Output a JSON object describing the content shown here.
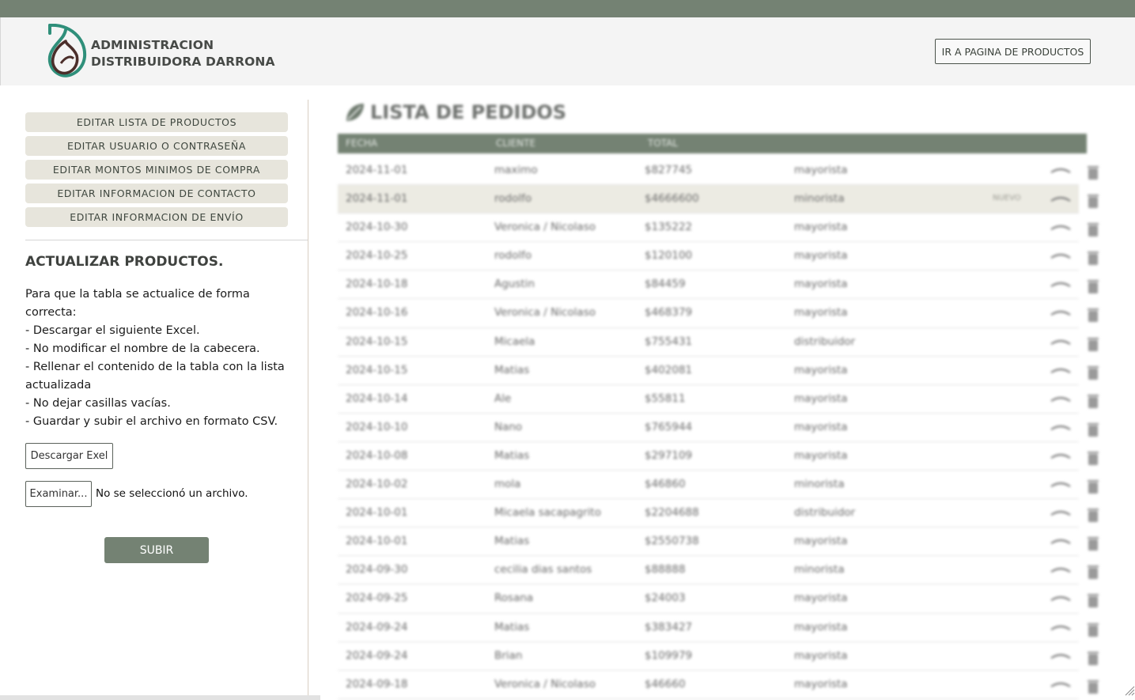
{
  "colors": {
    "accent": "#748273",
    "sidebar_button_bg": "#e7e5dc",
    "highlight_row": "#ecebe3"
  },
  "header": {
    "brand_line1": "ADMINISTRACION",
    "brand_line2": "DISTRIBUIDORA DARRONA",
    "go_products_label": "IR A PAGINA DE PRODUCTOS",
    "logo_icon": "leaf-drop-logo"
  },
  "sidebar": {
    "menu": [
      {
        "label": "EDITAR LISTA DE PRODUCTOS"
      },
      {
        "label": "EDITAR USUARIO O CONTRASEÑA"
      },
      {
        "label": "EDITAR MONTOS MINIMOS DE COMPRA"
      },
      {
        "label": "EDITAR INFORMACION DE CONTACTO"
      },
      {
        "label": "EDITAR INFORMACION DE ENVÍO"
      }
    ],
    "update_title": "ACTUALIZAR PRODUCTOS.",
    "instructions": [
      "Para que la tabla se actualice de forma correcta:",
      "- Descargar el siguiente Excel.",
      "- No modificar el nombre de la cabecera.",
      "- Rellenar el contenido de la tabla con la lista actualizada",
      "- No dejar casillas vacías.",
      "- Guardar y subir el archivo en formato CSV."
    ],
    "download_label": "Descargar Exel",
    "browse_label": "Examinar...",
    "file_status": "No se seleccionó un archivo.",
    "submit_label": "SUBIR"
  },
  "orders": {
    "title": "LISTA DE PEDIDOS",
    "columns": {
      "date": "FECHA",
      "client": "CLIENTE",
      "total": "TOTAL"
    },
    "rows": [
      {
        "date": "2024-11-01",
        "client": "maximo",
        "total": "$827745",
        "type": "mayorista",
        "badge": ""
      },
      {
        "date": "2024-11-01",
        "client": "rodolfo",
        "total": "$4666600",
        "type": "minorista",
        "badge": "NUEVO"
      },
      {
        "date": "2024-10-30",
        "client": "Veronica / Nicolaso",
        "total": "$135222",
        "type": "mayorista",
        "badge": ""
      },
      {
        "date": "2024-10-25",
        "client": "rodolfo",
        "total": "$120100",
        "type": "mayorista",
        "badge": ""
      },
      {
        "date": "2024-10-18",
        "client": "Agustin",
        "total": "$84459",
        "type": "mayorista",
        "badge": ""
      },
      {
        "date": "2024-10-16",
        "client": "Veronica / Nicolaso",
        "total": "$468379",
        "type": "mayorista",
        "badge": ""
      },
      {
        "date": "2024-10-15",
        "client": "Micaela",
        "total": "$755431",
        "type": "distribuidor",
        "badge": ""
      },
      {
        "date": "2024-10-15",
        "client": "Matias",
        "total": "$402081",
        "type": "mayorista",
        "badge": ""
      },
      {
        "date": "2024-10-14",
        "client": "Ale",
        "total": "$55811",
        "type": "mayorista",
        "badge": ""
      },
      {
        "date": "2024-10-10",
        "client": "Nano",
        "total": "$765944",
        "type": "mayorista",
        "badge": ""
      },
      {
        "date": "2024-10-08",
        "client": "Matias",
        "total": "$297109",
        "type": "mayorista",
        "badge": ""
      },
      {
        "date": "2024-10-02",
        "client": "mola",
        "total": "$46860",
        "type": "minorista",
        "badge": ""
      },
      {
        "date": "2024-10-01",
        "client": "Micaela sacapagrito",
        "total": "$2204688",
        "type": "distribuidor",
        "badge": ""
      },
      {
        "date": "2024-10-01",
        "client": "Matias",
        "total": "$2550738",
        "type": "mayorista",
        "badge": ""
      },
      {
        "date": "2024-09-30",
        "client": "cecilia dias santos",
        "total": "$88888",
        "type": "minorista",
        "badge": ""
      },
      {
        "date": "2024-09-25",
        "client": "Rosana",
        "total": "$24003",
        "type": "mayorista",
        "badge": ""
      },
      {
        "date": "2024-09-24",
        "client": "Matias",
        "total": "$383427",
        "type": "mayorista",
        "badge": ""
      },
      {
        "date": "2024-09-24",
        "client": "Brian",
        "total": "$109979",
        "type": "mayorista",
        "badge": ""
      },
      {
        "date": "2024-09-18",
        "client": "Veronica / Nicolaso",
        "total": "$46660",
        "type": "mayorista",
        "badge": ""
      }
    ],
    "row_icons": {
      "expand": "chevron-up-icon",
      "delete": "trash-icon"
    }
  }
}
